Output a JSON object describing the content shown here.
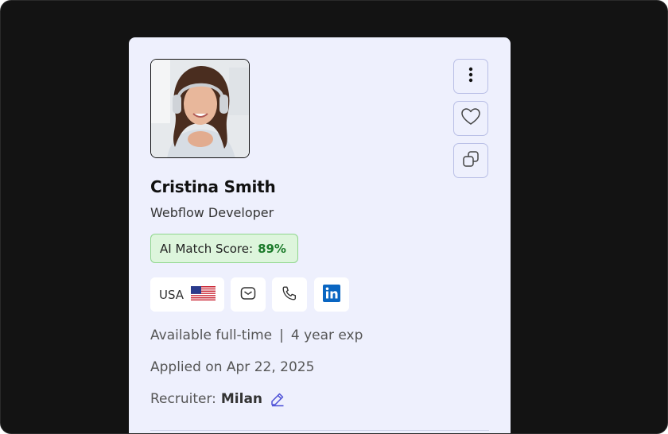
{
  "candidate": {
    "name": "Cristina Smith",
    "role": "Webflow Developer",
    "match_score_label": "AI Match Score:",
    "match_score_value": "89%",
    "country": "USA",
    "availability": "Available full-time",
    "experience": "4 year exp",
    "separator": "|",
    "applied": "Applied on Apr 22, 2025",
    "recruiter_label": "Recruiter:",
    "recruiter_name": "Milan"
  },
  "icons": {
    "more": "more-vertical-icon",
    "favorite": "heart-icon",
    "copy": "copy-icon",
    "email": "mail-icon",
    "phone": "phone-icon",
    "linkedin": "linkedin-icon",
    "edit": "pencil-icon",
    "flag": "us-flag-icon"
  },
  "colors": {
    "card_bg": "#eef0fd",
    "score_bg": "#ddf5dc",
    "score_value": "#1b7a2a",
    "linkedin": "#0a66c2",
    "edit_icon": "#4b4fd6"
  }
}
